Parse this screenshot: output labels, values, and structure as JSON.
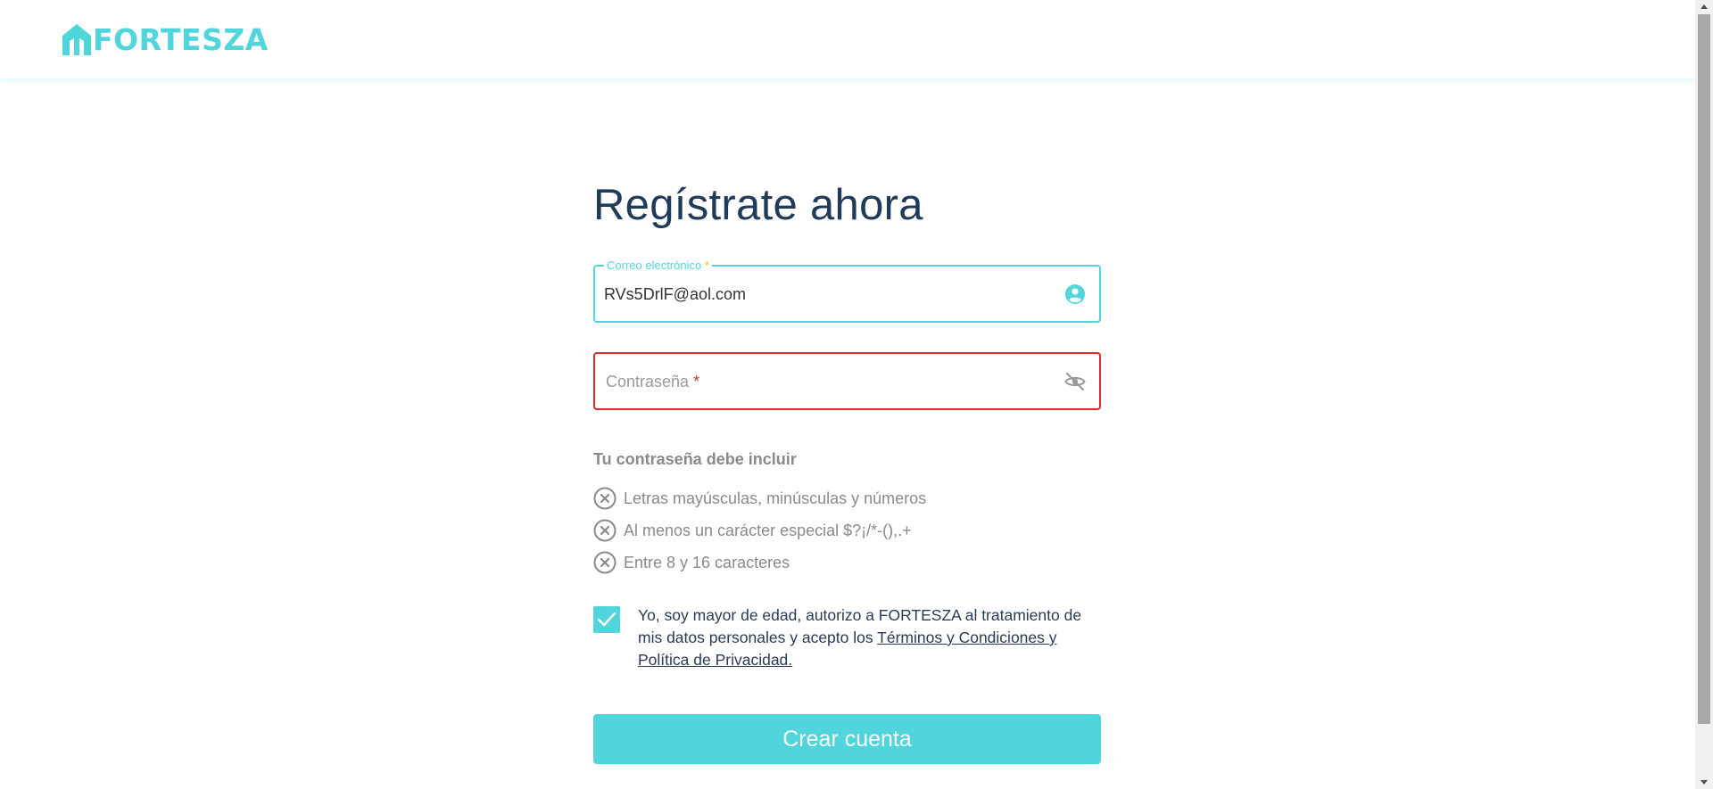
{
  "header": {
    "logo_text": "FORTESZA",
    "logo_icon": "house-logo-icon"
  },
  "form": {
    "title": "Regístrate ahora",
    "email": {
      "label": "Correo electrónico",
      "required_mark": "*",
      "value": "RVs5DrlF@aol.com",
      "icon": "account-circle-icon"
    },
    "password": {
      "placeholder": "Contraseña",
      "required_mark": "*",
      "value": "",
      "icon": "eye-off-icon"
    },
    "rules_title": "Tu contraseña debe incluir",
    "rules": [
      {
        "text": "Letras mayúsculas, minúsculas y números",
        "met": false
      },
      {
        "text": "Al menos un carácter especial $?¡/*-(),.+",
        "met": false
      },
      {
        "text": "Entre 8 y 16 caracteres",
        "met": false
      }
    ],
    "consent": {
      "checked": true,
      "text": "Yo, soy mayor de edad, autorizo a FORTESZA al tratamiento de mis datos personales y acepto los ",
      "link_text": "Términos y Condiciones y Política de Privacidad."
    },
    "submit_label": "Crear cuenta"
  },
  "colors": {
    "accent": "#50d5dc",
    "error": "#e0292f",
    "title": "#203a5a",
    "muted": "#8a8a8a",
    "required_mark": "#f0c419"
  }
}
